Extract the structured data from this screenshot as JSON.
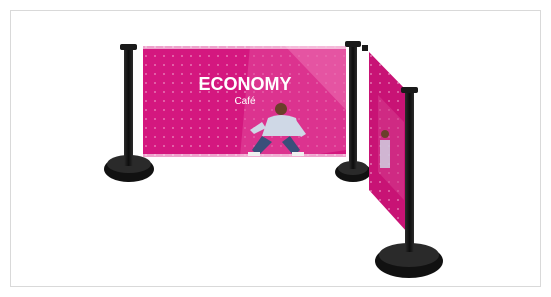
{
  "product_image": {
    "subject": "cafe-barrier-banner-system",
    "banner": {
      "brand_text": "ECONOMY",
      "sub_text": "Café",
      "colors": {
        "magenta": "#d4177f",
        "magenta_dark": "#b0126a",
        "stripe": "#e24a9c",
        "text": "#ffffff",
        "post": "#1a1a1a"
      }
    }
  }
}
